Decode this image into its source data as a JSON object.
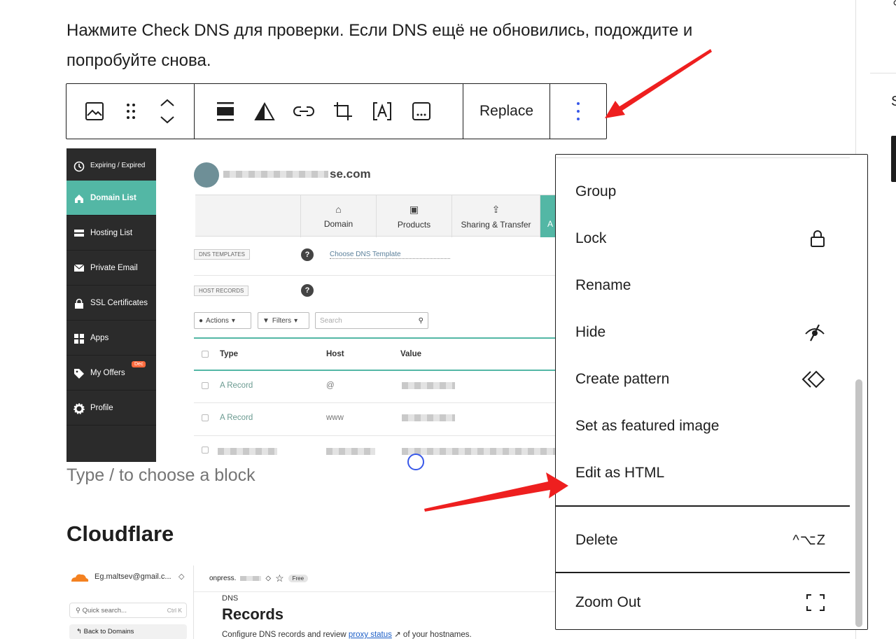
{
  "paragraph": "Нажмите Check DNS для проверки. Если DNS ещё не обновились, подождите и попробуйте снова.",
  "toolbar": {
    "replace_label": "Replace",
    "icons": [
      "image-icon",
      "drag-handle-icon",
      "move-up-down-icon",
      "align-icon",
      "contrast-icon",
      "link-icon",
      "crop-icon",
      "text-overlay-icon",
      "more-horizontal-icon",
      "more-vertical-icon"
    ]
  },
  "namecheap": {
    "sidebar": [
      {
        "label": "Expiring / Expired"
      },
      {
        "label": "Domain List"
      },
      {
        "label": "Hosting List"
      },
      {
        "label": "Private Email"
      },
      {
        "label": "SSL Certificates"
      },
      {
        "label": "Apps"
      },
      {
        "label": "My Offers",
        "badge": "Dec"
      },
      {
        "label": "Profile"
      }
    ],
    "domain_suffix": "se.com",
    "tabs": [
      "Domain",
      "Products",
      "Sharing & Transfer",
      "A"
    ],
    "dns_templates_label": "DNS TEMPLATES",
    "host_records_label": "HOST RECORDS",
    "question": "?",
    "choose_template": "Choose DNS Template",
    "actions": "Actions",
    "filters": "Filters",
    "search_placeholder": "Search",
    "columns": [
      "Type",
      "Host",
      "Value"
    ],
    "rows": [
      {
        "type": "A Record",
        "host": "@"
      },
      {
        "type": "A Record",
        "host": "www"
      }
    ]
  },
  "placeholder": "Type / to choose a block",
  "heading": "Cloudflare",
  "cloudflare": {
    "account": "Eg.maltsev@gmail.c...",
    "updown": "◇",
    "search": "Quick search...",
    "search_key": "Ctrl K",
    "back": "Back to Domains",
    "zone": "onpress.",
    "zone_plan": "Free",
    "section": "DNS",
    "title": "Records",
    "desc_before": "Configure DNS records and review ",
    "desc_link": "proxy status",
    "desc_after": " of your hostnames."
  },
  "menu": {
    "items": [
      {
        "label": "Group",
        "icon": ""
      },
      {
        "label": "Lock",
        "icon": "lock-icon"
      },
      {
        "label": "Rename",
        "icon": ""
      },
      {
        "label": "Hide",
        "icon": "hide-icon"
      },
      {
        "label": "Create pattern",
        "icon": "pattern-icon"
      },
      {
        "label": "Set as featured image",
        "icon": ""
      },
      {
        "label": "Edit as HTML",
        "icon": ""
      }
    ],
    "delete_label": "Delete",
    "delete_shortcut": "^⌥Z",
    "zoom_label": "Zoom Out",
    "right_panel_letter": "S"
  },
  "colors": {
    "annotation_arrow": "#ee1f1f",
    "namecheap_teal": "#53b7a5",
    "focus_blue": "#3858e9"
  }
}
